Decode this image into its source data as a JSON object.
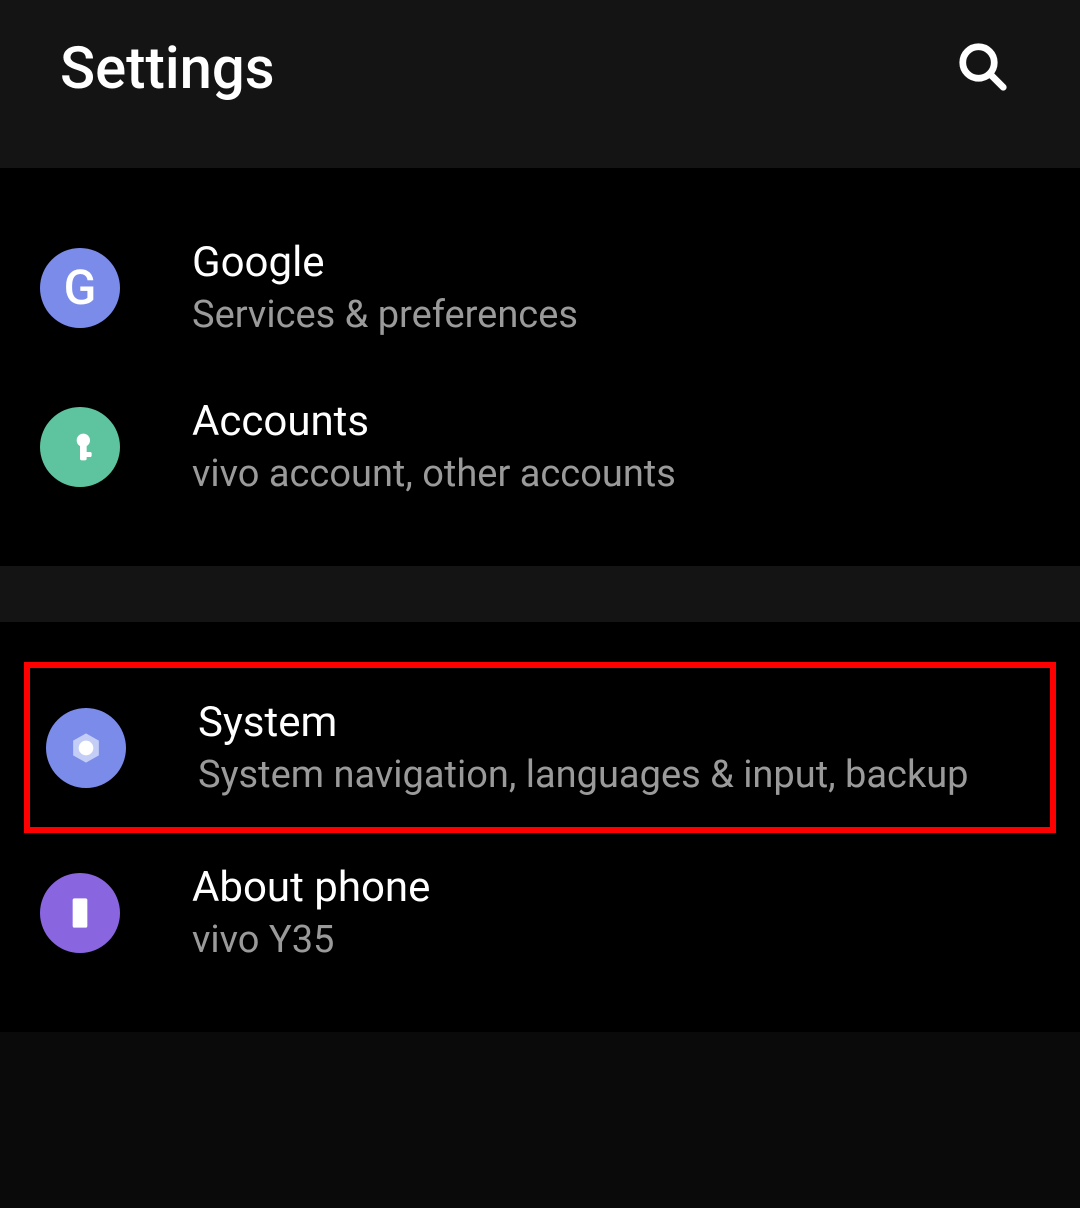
{
  "header": {
    "title": "Settings"
  },
  "groups": [
    {
      "items": [
        {
          "title": "Google",
          "subtitle": "Services & preferences"
        },
        {
          "title": "Accounts",
          "subtitle": "vivo account, other accounts"
        }
      ]
    },
    {
      "items": [
        {
          "title": "System",
          "subtitle": "System navigation, languages & input, backup"
        },
        {
          "title": "About phone",
          "subtitle": "vivo Y35"
        }
      ]
    }
  ]
}
